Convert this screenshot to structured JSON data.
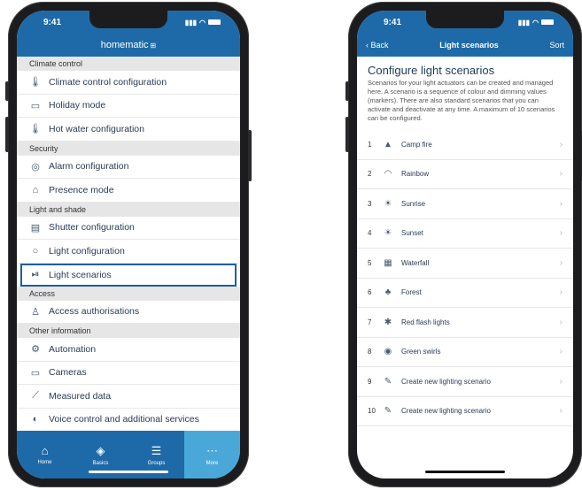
{
  "left": {
    "status_time": "9:41",
    "app_title": "homematic",
    "sections": [
      {
        "header": "Climate control",
        "items": [
          {
            "label": "Climate control configuration",
            "icon": "thermometer-icon"
          },
          {
            "label": "Holiday mode",
            "icon": "suitcase-icon"
          },
          {
            "label": "Hot water configuration",
            "icon": "thermometer-icon"
          }
        ]
      },
      {
        "header": "Security",
        "items": [
          {
            "label": "Alarm configuration",
            "icon": "alarm-icon"
          },
          {
            "label": "Presence mode",
            "icon": "house-icon"
          }
        ]
      },
      {
        "header": "Light and shade",
        "items": [
          {
            "label": "Shutter configuration",
            "icon": "shutter-icon"
          },
          {
            "label": "Light configuration",
            "icon": "bulb-icon"
          },
          {
            "label": "Light scenarios",
            "icon": "play-pause-icon",
            "selected": true
          }
        ]
      },
      {
        "header": "Access",
        "items": [
          {
            "label": "Access authorisations",
            "icon": "person-icon"
          }
        ]
      },
      {
        "header": "Other information",
        "items": [
          {
            "label": "Automation",
            "icon": "gear-icon"
          },
          {
            "label": "Cameras",
            "icon": "camera-icon"
          },
          {
            "label": "Measured data",
            "icon": "chart-icon"
          },
          {
            "label": "Voice control and additional services",
            "icon": "voice-icon"
          }
        ]
      }
    ],
    "tabs": [
      {
        "label": "Home",
        "icon": "home-icon"
      },
      {
        "label": "Basics",
        "icon": "basics-icon"
      },
      {
        "label": "Groups",
        "icon": "groups-icon"
      },
      {
        "label": "More",
        "icon": "more-icon",
        "active": true
      }
    ]
  },
  "right": {
    "status_time": "9:41",
    "back_label": "Back",
    "nav_title": "Light scenarios",
    "sort_label": "Sort",
    "heading": "Configure light scenarios",
    "description": "Scenarios for your light actuators can be created and managed here. A scenario is a sequence of colour and dimming values (markers). There are also standard scenarios that you can activate and deactivate at any time. A maximum of 10 scenarios can be configured.",
    "scenarios": [
      {
        "num": "1",
        "label": "Camp fire",
        "icon": "campfire-icon"
      },
      {
        "num": "2",
        "label": "Rainbow",
        "icon": "rainbow-icon"
      },
      {
        "num": "3",
        "label": "Sunrise",
        "icon": "sunrise-icon"
      },
      {
        "num": "4",
        "label": "Sunset",
        "icon": "sunset-icon"
      },
      {
        "num": "5",
        "label": "Waterfall",
        "icon": "waterfall-icon"
      },
      {
        "num": "6",
        "label": "Forest",
        "icon": "forest-icon"
      },
      {
        "num": "7",
        "label": "Red flash lights",
        "icon": "flash-icon"
      },
      {
        "num": "8",
        "label": "Green swirls",
        "icon": "swirl-icon"
      },
      {
        "num": "9",
        "label": "Create new lighting scenario",
        "icon": "create-icon"
      },
      {
        "num": "10",
        "label": "Create new lighting scenario",
        "icon": "create-icon"
      }
    ]
  }
}
